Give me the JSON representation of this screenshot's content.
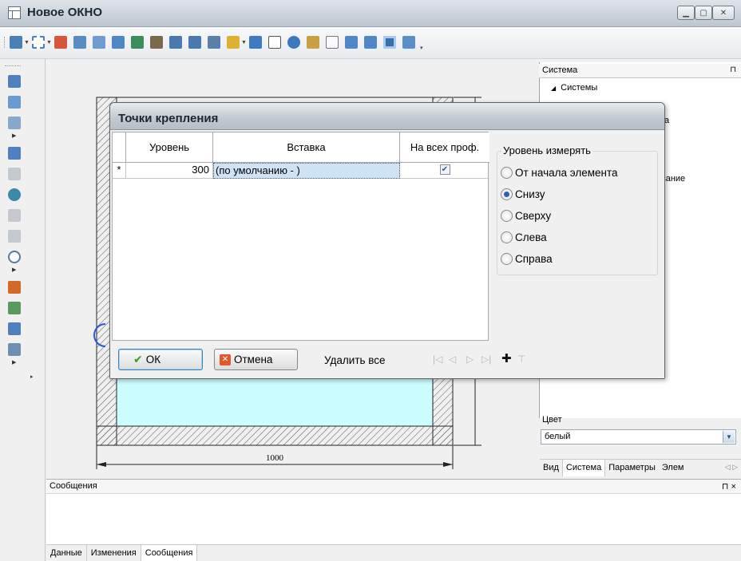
{
  "window": {
    "title": "Новое ОКНО"
  },
  "system_panel": {
    "header": "Система",
    "pin": "⊓",
    "tree_root": "Системы",
    "tree_fragment_a": "а",
    "tree_fragment_b": "вание"
  },
  "color": {
    "label": "Цвет",
    "value": "белый"
  },
  "right_tabs": [
    {
      "label": "Вид"
    },
    {
      "label": "Система",
      "active": true
    },
    {
      "label": "Параметры"
    },
    {
      "label": "Элем"
    }
  ],
  "messages": {
    "header": "Сообщения",
    "controls": "⊓ ×"
  },
  "bottom_tabs": [
    {
      "label": "Данные"
    },
    {
      "label": "Изменения"
    },
    {
      "label": "Сообщения",
      "active": true
    }
  ],
  "drawing": {
    "dimension_label": "1000",
    "glass_color": "#ccfdfe"
  },
  "dialog": {
    "title": "Точки крепления",
    "grid": {
      "headers": [
        "Уровень",
        "Вставка",
        "На всех проф."
      ],
      "new_row_marker": "*",
      "row": {
        "level": "300",
        "insert": "(по умолчанию - )",
        "all_profiles": true
      }
    },
    "level_group": {
      "legend": "Уровень измерять",
      "options": [
        {
          "label": "От начала элемента",
          "selected": false
        },
        {
          "label": "Снизу",
          "selected": true
        },
        {
          "label": "Сверху",
          "selected": false
        },
        {
          "label": "Слева",
          "selected": false
        },
        {
          "label": "Справа",
          "selected": false
        }
      ]
    },
    "buttons": {
      "ok": "ОК",
      "cancel": "Отмена",
      "delete_all": "Удалить все"
    }
  },
  "colors": {
    "selection": "#cfe3f7",
    "accent": "#2f5fb3"
  }
}
